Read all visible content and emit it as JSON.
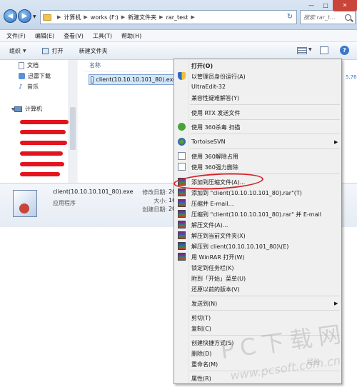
{
  "window": {
    "address": [
      "计算机",
      "works (F:)",
      "新建文件夹",
      "rar_test"
    ],
    "search_placeholder": "搜索 rar_t...",
    "minimize": "—",
    "maximize": "□",
    "close": "✕"
  },
  "menubar": [
    "文件(F)",
    "编辑(E)",
    "查看(V)",
    "工具(T)",
    "帮助(H)"
  ],
  "toolbar": {
    "organize": "组织",
    "open": "打开",
    "new_folder": "新建文件夹"
  },
  "navpane": {
    "items": [
      "文档",
      "迅雷下载",
      "音乐",
      "计算机"
    ]
  },
  "filelist": {
    "column_name": "名称",
    "file": "client(10.10.10.101_80).exe",
    "right_edge": "5,76"
  },
  "details": {
    "name": "client(10.10.10.101_80).exe",
    "type": "应用程序",
    "modified_label": "修改日期:",
    "modified_value": "201",
    "size_label": "大小:",
    "size_value": "16.",
    "created_label": "创建日期:",
    "created_value": "201"
  },
  "context_menu": {
    "items": [
      "打开(O)",
      "以管理员身份运行(A)",
      "UltraEdit-32",
      "兼容性疑难解答(Y)",
      "使用 RTX 发送文件",
      "使用 360杀毒 扫描",
      "TortoiseSVN",
      "使用 360解除占用",
      "使用 360强力删除",
      "添加到压缩文件(A)...",
      "添加到 \"client(10.10.10.101_80).rar\"(T)",
      "压缩并 E-mail...",
      "压缩到 \"client(10.10.10.101_80).rar\" 并 E-mail",
      "解压文件(A)...",
      "解压到当前文件夹(X)",
      "解压到 client(10.10.10.101_80)\\(E)",
      "用 WinRAR 打开(W)",
      "锁定到任务栏(K)",
      "附到「开始」菜单(U)",
      "还原以前的版本(V)",
      "发送到(N)",
      "剪切(T)",
      "复制(C)",
      "创建快捷方式(S)",
      "删除(D)",
      "重命名(M)",
      "属性(R)"
    ]
  },
  "watermark": {
    "big": "PC下载网",
    "url": "www.pcsoft.com.cn",
    "jingyan": "经验"
  },
  "colors": {
    "highlight_oval": "#d5242c",
    "redaction": "#e3141e"
  }
}
